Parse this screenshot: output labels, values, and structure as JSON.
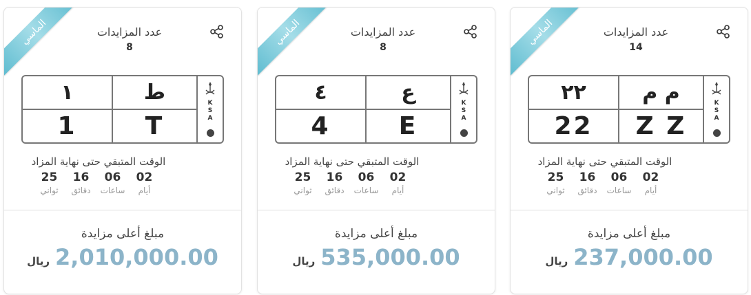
{
  "cards": [
    {
      "badge": "الماسي",
      "bids_label": "عدد المزايدات",
      "bids_count": "14",
      "plate": {
        "ar_letters": "م م",
        "ar_numbers": "٢٢",
        "en_letters": "Z Z",
        "en_numbers": "22",
        "country": "K\nS\nA"
      },
      "time_title": "الوقت المتبقي حتى نهاية المزاد",
      "timer": [
        {
          "value": "02",
          "label": "أيام"
        },
        {
          "value": "06",
          "label": "ساعات"
        },
        {
          "value": "16",
          "label": "دقائق"
        },
        {
          "value": "25",
          "label": "ثواني"
        }
      ],
      "price_label": "مبلغ أعلى مزايدة",
      "price": "237,000.00",
      "currency": "ريال"
    },
    {
      "badge": "الماسي",
      "bids_label": "عدد المزايدات",
      "bids_count": "8",
      "plate": {
        "ar_letters": "ع",
        "ar_numbers": "٤",
        "en_letters": "E",
        "en_numbers": "4",
        "country": "K\nS\nA"
      },
      "time_title": "الوقت المتبقي حتى نهاية المزاد",
      "timer": [
        {
          "value": "02",
          "label": "أيام"
        },
        {
          "value": "06",
          "label": "ساعات"
        },
        {
          "value": "16",
          "label": "دقائق"
        },
        {
          "value": "25",
          "label": "ثواني"
        }
      ],
      "price_label": "مبلغ أعلى مزايدة",
      "price": "535,000.00",
      "currency": "ريال"
    },
    {
      "badge": "الماسي",
      "bids_label": "عدد المزايدات",
      "bids_count": "8",
      "plate": {
        "ar_letters": "ط",
        "ar_numbers": "١",
        "en_letters": "T",
        "en_numbers": "1",
        "country": "K\nS\nA"
      },
      "time_title": "الوقت المتبقي حتى نهاية المزاد",
      "timer": [
        {
          "value": "02",
          "label": "أيام"
        },
        {
          "value": "06",
          "label": "ساعات"
        },
        {
          "value": "16",
          "label": "دقائق"
        },
        {
          "value": "25",
          "label": "ثواني"
        }
      ],
      "price_label": "مبلغ أعلى مزايدة",
      "price": "2,010,000.00",
      "currency": "ريال"
    }
  ],
  "icons": {
    "share": "share-icon",
    "emblem": "saudi-emblem-icon"
  },
  "colors": {
    "ribbon": "#5fbcd0",
    "price": "#8cb4c9",
    "border": "#777777"
  }
}
